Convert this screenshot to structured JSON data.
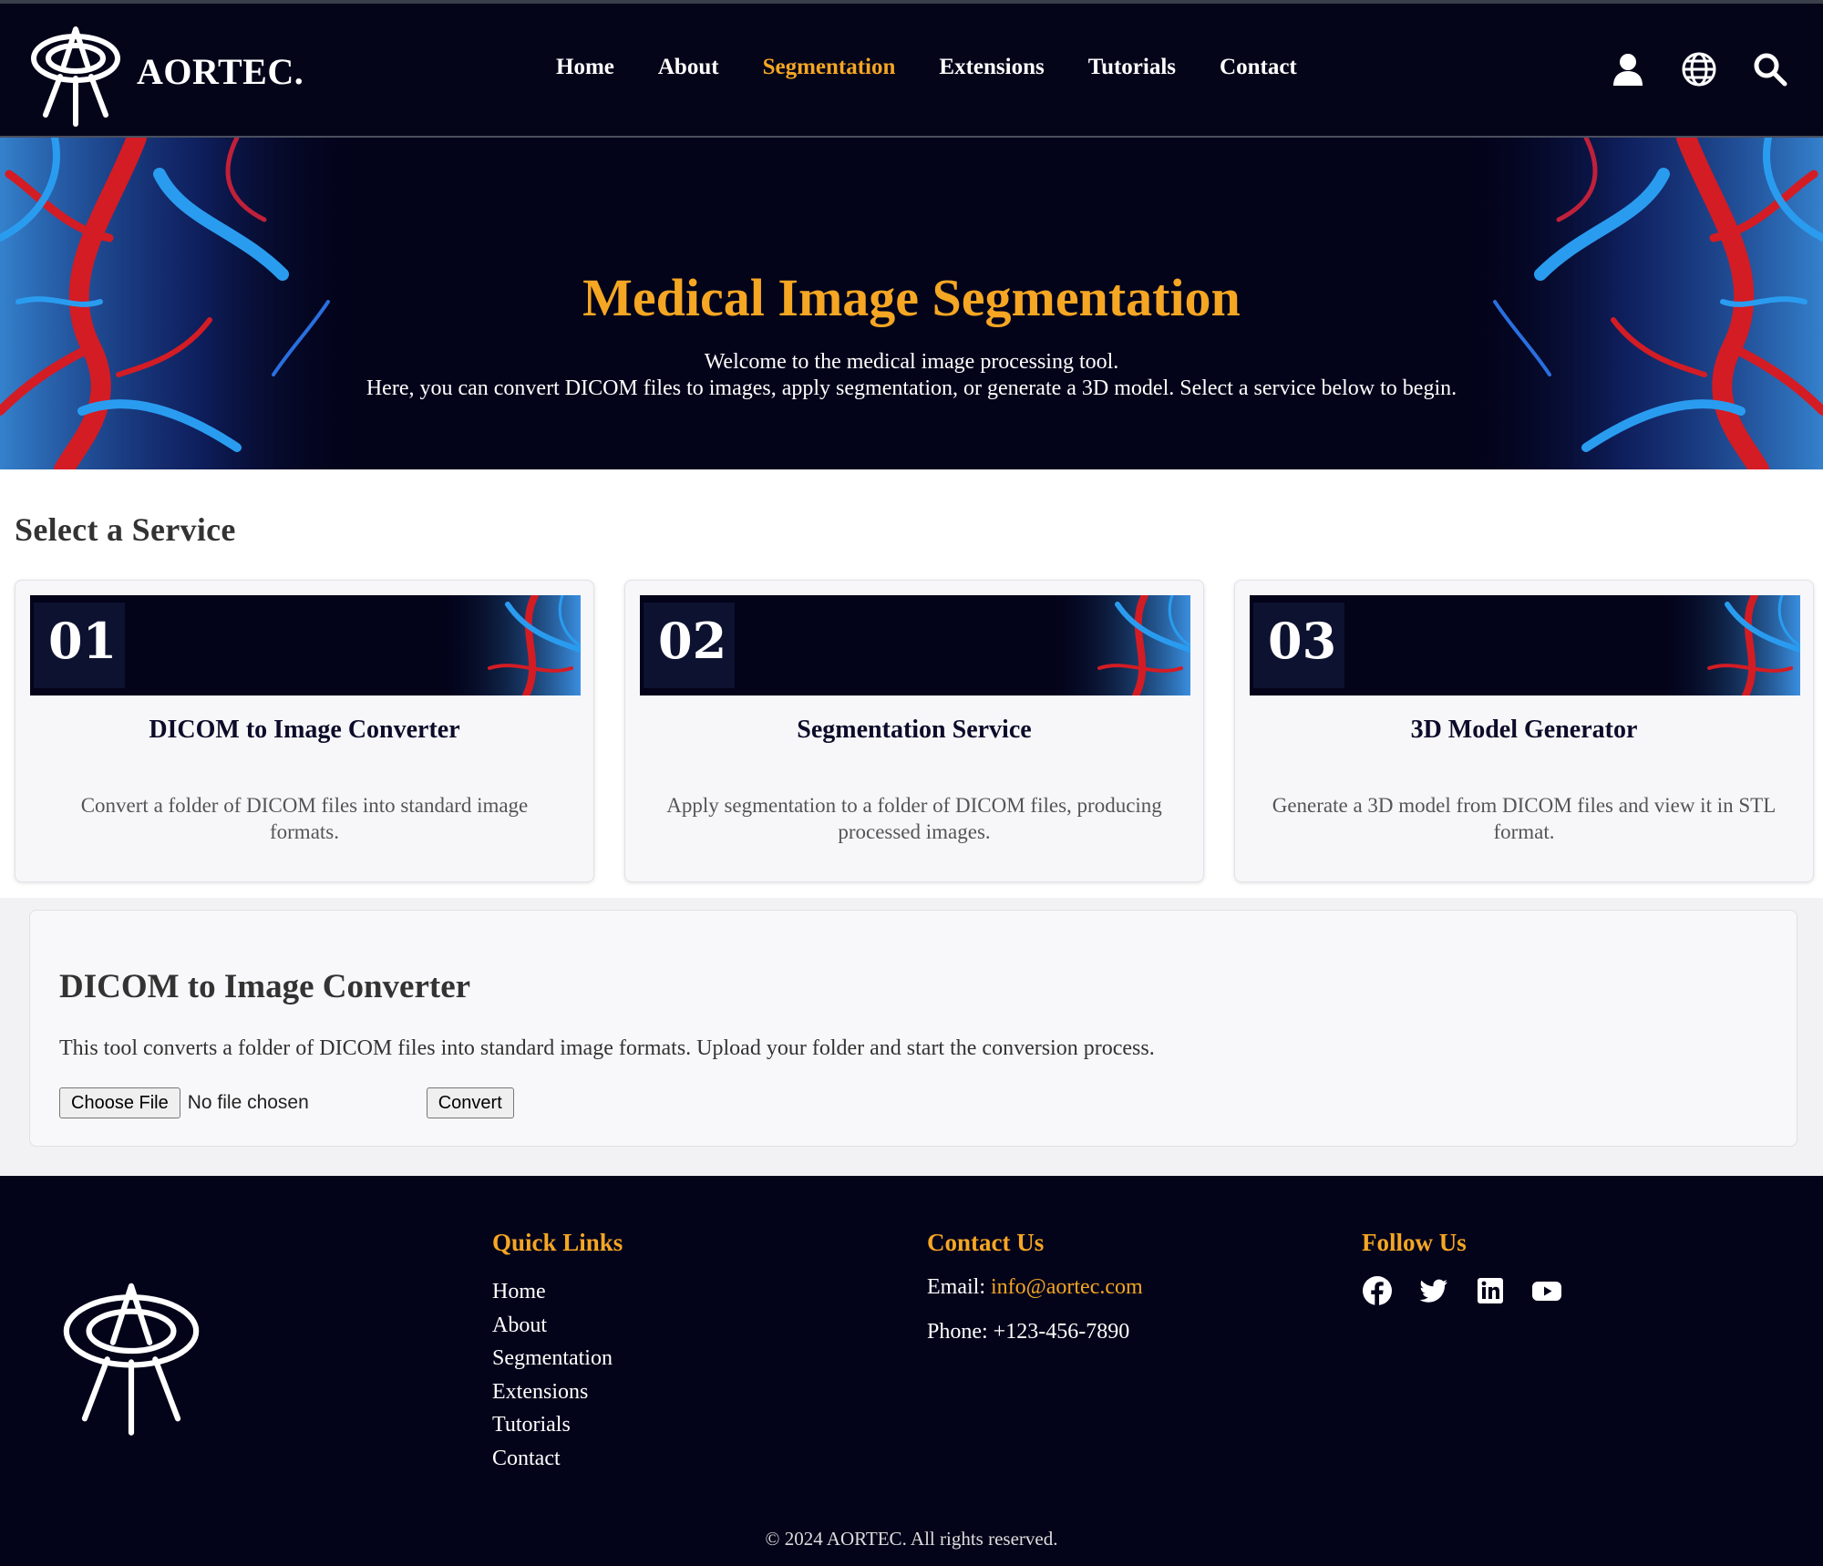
{
  "header": {
    "brand": "AORTEC.",
    "nav": [
      {
        "label": "Home",
        "active": false
      },
      {
        "label": "About",
        "active": false
      },
      {
        "label": "Segmentation",
        "active": true
      },
      {
        "label": "Extensions",
        "active": false
      },
      {
        "label": "Tutorials",
        "active": false
      },
      {
        "label": "Contact",
        "active": false
      }
    ],
    "icons": [
      "user-icon",
      "globe-icon",
      "search-icon"
    ]
  },
  "hero": {
    "title": "Medical Image Segmentation",
    "line1": "Welcome to the medical image processing tool.",
    "line2": "Here, you can convert DICOM files to images, apply segmentation, or generate a 3D model. Select a service below to begin."
  },
  "services": {
    "heading": "Select a Service",
    "cards": [
      {
        "number": "01",
        "title": "DICOM to Image Converter",
        "description": "Convert a folder of DICOM files into standard image formats."
      },
      {
        "number": "02",
        "title": "Segmentation Service",
        "description": "Apply segmentation to a folder of DICOM files, producing processed images."
      },
      {
        "number": "03",
        "title": "3D Model Generator",
        "description": "Generate a 3D model from DICOM files and view it in STL format."
      }
    ]
  },
  "tool": {
    "title": "DICOM to Image Converter",
    "description": "This tool converts a folder of DICOM files into standard image formats. Upload your folder and start the conversion process.",
    "choose_label": "Choose File",
    "file_status": "No file chosen",
    "convert_label": "Convert"
  },
  "footer": {
    "quick_links_title": "Quick Links",
    "quick_links": [
      "Home",
      "About",
      "Segmentation",
      "Extensions",
      "Tutorials",
      "Contact"
    ],
    "contact_title": "Contact Us",
    "email_label": "Email:",
    "email": "info@aortec.com",
    "phone_label": "Phone:",
    "phone": "+123-456-7890",
    "follow_title": "Follow Us",
    "social": [
      "facebook-icon",
      "twitter-icon",
      "linkedin-icon",
      "youtube-icon"
    ],
    "copyright": "© 2024 AORTEC. All rights reserved."
  },
  "colors": {
    "accent": "#f5a623",
    "navy": "#03031a",
    "card_bg": "#f7f7f9"
  }
}
